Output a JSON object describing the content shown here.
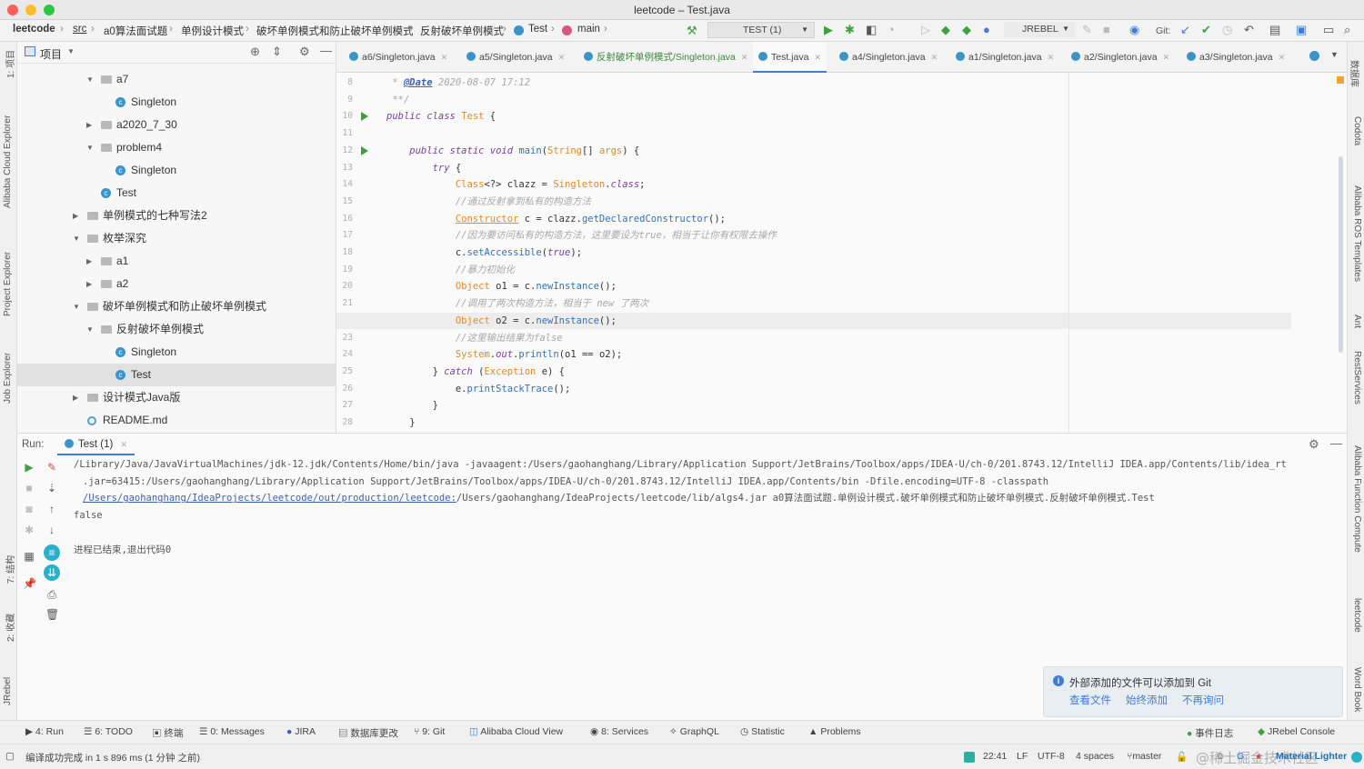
{
  "window": {
    "title": "leetcode – Test.java"
  },
  "breadcrumbs": [
    "leetcode",
    "src",
    "a0算法面试题",
    "单例设计模式",
    "破坏单例模式和防止破坏单例模式",
    "反射破坏单例模式",
    "Test",
    "main"
  ],
  "toolbar": {
    "run_config": "TEST (1)",
    "jrebel": "JREBEL",
    "git_label": "Git:"
  },
  "left_strip": [
    "1: 项目",
    "Alibaba Cloud Explorer",
    "Project Explorer",
    "Job Explorer",
    "7: 结构",
    "2: 收藏",
    "JRebel"
  ],
  "right_strip": [
    "数据库",
    "Codota",
    "Alibaba ROS Templates",
    "Ant",
    "RestServices",
    "Alibaba Function Compute",
    "leetcode",
    "Word Book"
  ],
  "project": {
    "title": "项目",
    "tree": [
      {
        "label": "a7",
        "kind": "folder",
        "expanded": true
      },
      {
        "label": "Singleton",
        "kind": "class"
      },
      {
        "label": "a2020_7_30",
        "kind": "folder",
        "expanded": false
      },
      {
        "label": "problem4",
        "kind": "folder",
        "expanded": true
      },
      {
        "label": "Singleton",
        "kind": "class"
      },
      {
        "label": "Test",
        "kind": "class"
      },
      {
        "label": "单例模式的七种写法2",
        "kind": "folder",
        "expanded": false
      },
      {
        "label": "枚举深究",
        "kind": "folder",
        "expanded": true
      },
      {
        "label": "a1",
        "kind": "folder",
        "expanded": false
      },
      {
        "label": "a2",
        "kind": "folder",
        "expanded": false
      },
      {
        "label": "破坏单例模式和防止破坏单例模式",
        "kind": "folder",
        "expanded": true
      },
      {
        "label": "反射破坏单例模式",
        "kind": "folder",
        "expanded": true
      },
      {
        "label": "Singleton",
        "kind": "class"
      },
      {
        "label": "Test",
        "kind": "class",
        "selected": true
      },
      {
        "label": "设计模式Java版",
        "kind": "folder",
        "expanded": false
      },
      {
        "label": "README.md",
        "kind": "readme"
      }
    ]
  },
  "editor": {
    "tabs": [
      {
        "label": "a6/Singleton.java",
        "active": false
      },
      {
        "label": "a5/Singleton.java",
        "active": false
      },
      {
        "label": "反射破坏单例模式/Singleton.java",
        "active": false
      },
      {
        "label": "Test.java",
        "active": true
      },
      {
        "label": "a4/Singleton.java",
        "active": false
      },
      {
        "label": "a1/Singleton.java",
        "active": false
      },
      {
        "label": "a2/Singleton.java",
        "active": false
      },
      {
        "label": "a3/Singleton.java",
        "active": false
      }
    ],
    "current_line": "22",
    "lines": [
      {
        "n": "8",
        "parts": [
          {
            "t": " * ",
            "c": "cm"
          },
          {
            "t": "@Date",
            "c": "ann"
          },
          {
            "t": " 2020-08-07 17:12",
            "c": "cm"
          }
        ]
      },
      {
        "n": "9",
        "parts": [
          {
            "t": " **/",
            "c": "cm"
          }
        ]
      },
      {
        "n": "10",
        "run": true,
        "parts": [
          {
            "t": "public class ",
            "c": "kw"
          },
          {
            "t": "Test",
            "c": "ty"
          },
          {
            "t": " {",
            "c": "tx"
          }
        ]
      },
      {
        "n": "11",
        "parts": []
      },
      {
        "n": "12",
        "run": true,
        "parts": [
          {
            "t": "    public static void ",
            "c": "kw"
          },
          {
            "t": "main",
            "c": "fn"
          },
          {
            "t": "(",
            "c": "tx"
          },
          {
            "t": "String",
            "c": "ty"
          },
          {
            "t": "[] ",
            "c": "tx"
          },
          {
            "t": "args",
            "c": "ty"
          },
          {
            "t": ") {",
            "c": "tx"
          }
        ]
      },
      {
        "n": "13",
        "parts": [
          {
            "t": "        try",
            "c": "kw"
          },
          {
            "t": " {",
            "c": "tx"
          }
        ]
      },
      {
        "n": "14",
        "parts": [
          {
            "t": "            Class",
            "c": "ty"
          },
          {
            "t": "<?> clazz = ",
            "c": "tx"
          },
          {
            "t": "Singleton",
            "c": "ty"
          },
          {
            "t": ".",
            "c": "tx"
          },
          {
            "t": "class",
            "c": "kw"
          },
          {
            "t": ";",
            "c": "tx"
          }
        ]
      },
      {
        "n": "15",
        "parts": [
          {
            "t": "            //通过反射拿到私有的构造方法",
            "c": "cm"
          }
        ]
      },
      {
        "n": "16",
        "parts": [
          {
            "t": "            ",
            "c": "tx"
          },
          {
            "t": "Constructor",
            "c": "ty ul"
          },
          {
            "t": " c = clazz.",
            "c": "tx"
          },
          {
            "t": "getDeclaredConstructor",
            "c": "fn"
          },
          {
            "t": "();",
            "c": "tx"
          }
        ]
      },
      {
        "n": "17",
        "parts": [
          {
            "t": "            //因为要访问私有的构造方法，这里要设为true，相当于让你有权限去操作",
            "c": "cm"
          }
        ]
      },
      {
        "n": "18",
        "parts": [
          {
            "t": "            c.",
            "c": "tx"
          },
          {
            "t": "setAccessible",
            "c": "fn"
          },
          {
            "t": "(",
            "c": "tx"
          },
          {
            "t": "true",
            "c": "kw"
          },
          {
            "t": ");",
            "c": "tx"
          }
        ]
      },
      {
        "n": "19",
        "parts": [
          {
            "t": "            //暴力初始化",
            "c": "cm"
          }
        ]
      },
      {
        "n": "20",
        "parts": [
          {
            "t": "            Object",
            "c": "ty"
          },
          {
            "t": " o1 = c.",
            "c": "tx"
          },
          {
            "t": "newInstance",
            "c": "fn"
          },
          {
            "t": "();",
            "c": "tx"
          }
        ]
      },
      {
        "n": "21",
        "parts": [
          {
            "t": "            //调用了两次构造方法，相当于 new 了两次",
            "c": "cm"
          }
        ]
      },
      {
        "n": "22",
        "parts": [
          {
            "t": "            Object",
            "c": "ty"
          },
          {
            "t": " o2 = c.",
            "c": "tx"
          },
          {
            "t": "newInstance",
            "c": "fn"
          },
          {
            "t": "();",
            "c": "tx"
          }
        ]
      },
      {
        "n": "23",
        "parts": [
          {
            "t": "            //这里输出结果为false",
            "c": "cm"
          }
        ]
      },
      {
        "n": "24",
        "parts": [
          {
            "t": "            System",
            "c": "ty"
          },
          {
            "t": ".",
            "c": "tx"
          },
          {
            "t": "out",
            "c": "kw"
          },
          {
            "t": ".",
            "c": "tx"
          },
          {
            "t": "println",
            "c": "fn"
          },
          {
            "t": "(o1 == o2);",
            "c": "tx"
          }
        ]
      },
      {
        "n": "25",
        "parts": [
          {
            "t": "        } ",
            "c": "tx"
          },
          {
            "t": "catch",
            "c": "kw"
          },
          {
            "t": " (",
            "c": "tx"
          },
          {
            "t": "Exception",
            "c": "ty"
          },
          {
            "t": " e) {",
            "c": "tx"
          }
        ]
      },
      {
        "n": "26",
        "parts": [
          {
            "t": "            e.",
            "c": "tx"
          },
          {
            "t": "printStackTrace",
            "c": "fn"
          },
          {
            "t": "();",
            "c": "tx"
          }
        ]
      },
      {
        "n": "27",
        "parts": [
          {
            "t": "        }",
            "c": "tx"
          }
        ]
      },
      {
        "n": "28",
        "parts": [
          {
            "t": "    }",
            "c": "tx"
          }
        ]
      }
    ]
  },
  "run": {
    "label": "Run:",
    "tab": "Test (1)",
    "output": [
      "/Library/Java/JavaVirtualMachines/jdk-12.jdk/Contents/Home/bin/java -javaagent:/Users/gaohanghang/Library/Application Support/JetBrains/Toolbox/apps/IDEA-U/ch-0/201.8743.12/IntelliJ IDEA.app/Contents/lib/idea_rt",
      ".jar=63415:/Users/gaohanghang/Library/Application Support/JetBrains/Toolbox/apps/IDEA-U/ch-0/201.8743.12/IntelliJ IDEA.app/Contents/bin -Dfile.encoding=UTF-8 -classpath",
      "/Users/gaohanghang/IdeaProjects/leetcode/out/production/leetcode:/Users/gaohanghang/IdeaProjects/leetcode/lib/algs4.jar a0算法面试题.单例设计模式.破坏单例模式和防止破坏单例模式.反射破坏单例模式.Test",
      "false",
      "",
      "进程已结束,退出代码0"
    ],
    "link_path": "/Users/gaohanghang/IdeaProjects/leetcode/out/production/leetcode:"
  },
  "notification": {
    "message": "外部添加的文件可以添加到 Git",
    "actions": [
      "查看文件",
      "始终添加",
      "不再询问"
    ]
  },
  "bottom_tabs": [
    "4: Run",
    "6: TODO",
    "终端",
    "0: Messages",
    "JIRA",
    "数据库更改",
    "9: Git",
    "Alibaba Cloud View",
    "8: Services",
    "GraphQL",
    "Statistic",
    "Problems",
    "事件日志",
    "JRebel Console"
  ],
  "status": {
    "message": "编译成功完成 in 1 s 896 ms (1 分钟 之前)",
    "position": "22:41",
    "line_sep": "LF",
    "encoding": "UTF-8",
    "indent": "4 spaces",
    "branch": "master",
    "theme": "Material Lighter",
    "watermark": "@稀土掘金技术社区"
  },
  "colors": {
    "accent": "#3e7cd8",
    "run_green": "#3aa33a",
    "keyword": "#7a3e9d",
    "type": "#e08a2a",
    "comment": "#a8a8a8"
  }
}
